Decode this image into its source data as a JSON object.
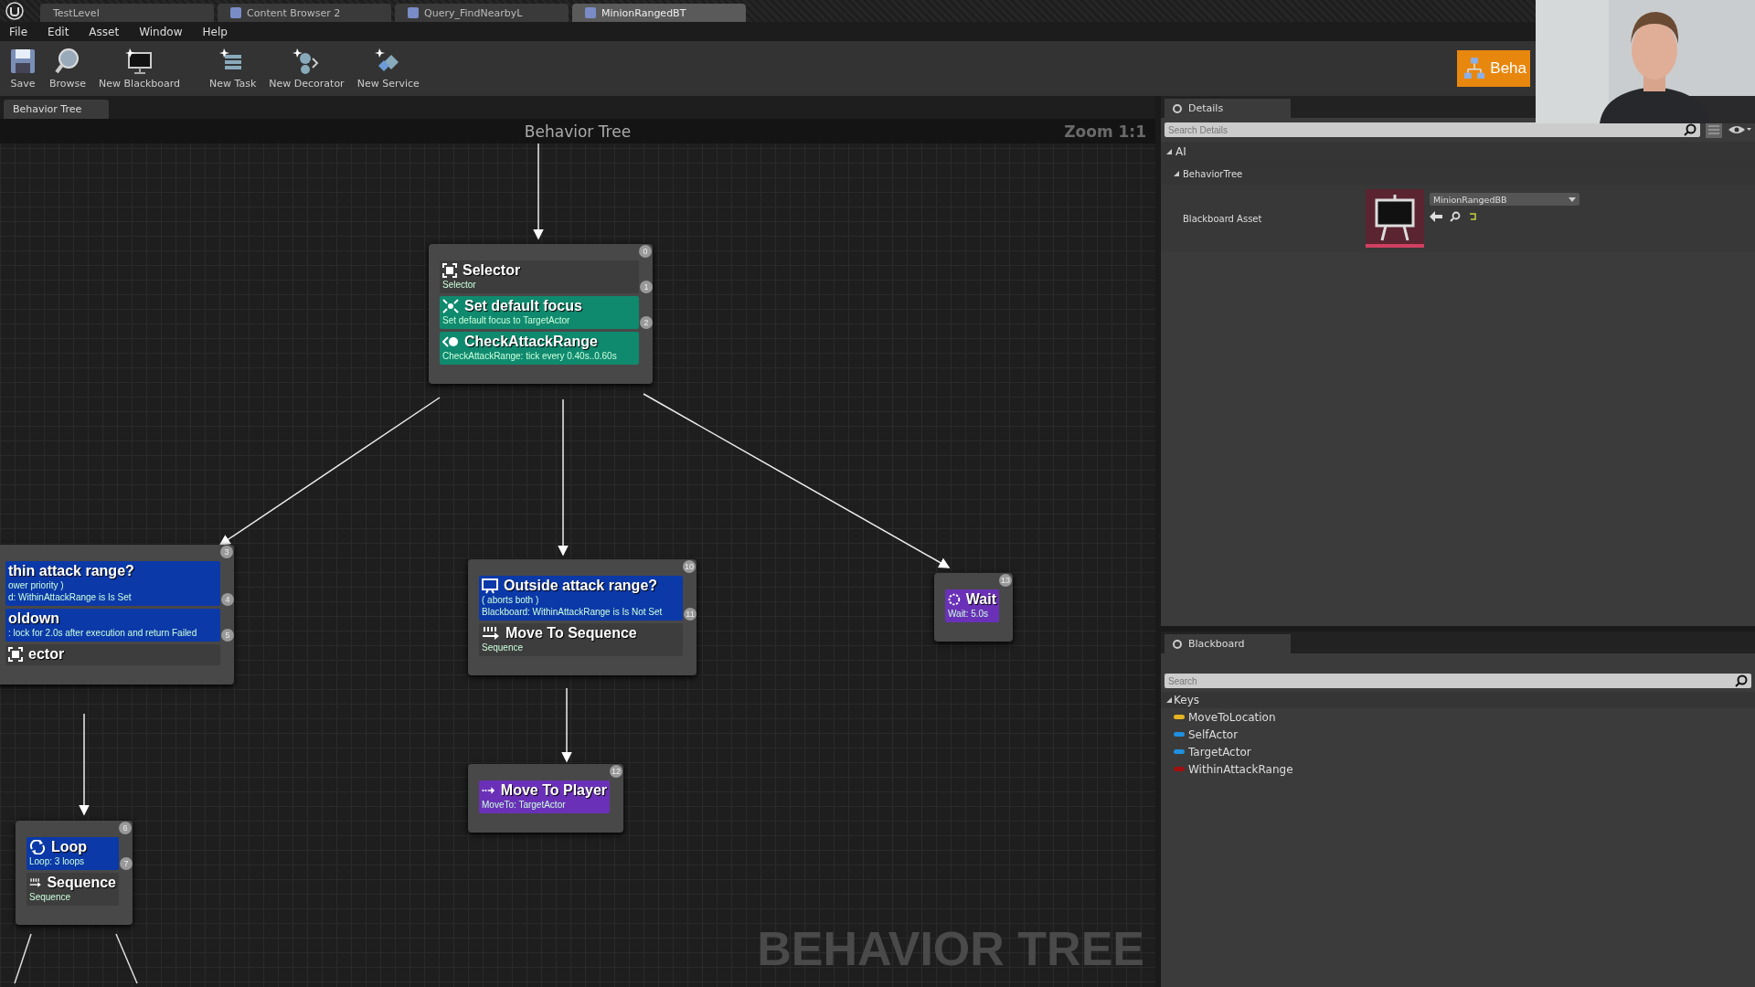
{
  "editor_tabs": [
    {
      "label": "TestLevel",
      "selected": false
    },
    {
      "label": "Content Browser 2",
      "selected": false
    },
    {
      "label": "Query_FindNearbyL",
      "selected": false
    },
    {
      "label": "MinionRangedBT",
      "selected": true
    }
  ],
  "menu": [
    "File",
    "Edit",
    "Asset",
    "Window",
    "Help"
  ],
  "toolbar": [
    {
      "label": "Save",
      "kind": "save"
    },
    {
      "label": "Browse",
      "kind": "browse"
    },
    {
      "label": "New Blackboard",
      "kind": "blackboard"
    },
    {
      "label": "New Task",
      "kind": "task"
    },
    {
      "label": "New Decorator",
      "kind": "decorator"
    },
    {
      "label": "New Service",
      "kind": "service"
    }
  ],
  "mode_button": {
    "label": "Beha"
  },
  "panel_tab": "Behavior Tree",
  "graph": {
    "title": "Behavior Tree",
    "zoom": "Zoom 1:1",
    "watermark": "BEHAVIOR TREE",
    "nodes": [
      {
        "index": "0",
        "sections": [
          {
            "kind": "composite",
            "title": "Selector",
            "lines": [
              "Selector"
            ],
            "badge": "1"
          },
          {
            "kind": "service",
            "title": "Set default focus",
            "lines": [
              "Set default focus to TargetActor"
            ],
            "badge": "2"
          },
          {
            "kind": "service",
            "title": "CheckAttackRange",
            "lines": [
              "CheckAttackRange: tick every 0.40s..0.60s"
            ]
          }
        ]
      },
      {
        "index": "3",
        "sections": [
          {
            "kind": "decorator",
            "title": "thin attack range?",
            "lines": [
              "ower priority )",
              "d: WithinAttackRange is Is Set"
            ],
            "badge": "4"
          },
          {
            "kind": "decorator",
            "title": "oldown",
            "lines": [
              ": lock for 2.0s after execution and return Failed"
            ],
            "badge": "5"
          },
          {
            "kind": "composite",
            "title": "ector"
          }
        ]
      },
      {
        "index": "10",
        "sections": [
          {
            "kind": "decorator",
            "title": "Outside attack range?",
            "lines": [
              "( aborts both )",
              "Blackboard: WithinAttackRange is Is Not Set"
            ],
            "badge": "11"
          },
          {
            "kind": "composite",
            "title": "Move To Sequence",
            "lines": [
              "Sequence"
            ]
          }
        ]
      },
      {
        "index": "13",
        "sections": [
          {
            "kind": "task",
            "title": "Wait",
            "lines": [
              "Wait: 5.0s"
            ]
          }
        ]
      },
      {
        "index": "12",
        "sections": [
          {
            "kind": "task",
            "title": "Move To Player",
            "lines": [
              "MoveTo: TargetActor"
            ]
          }
        ]
      },
      {
        "index": "6",
        "sections": [
          {
            "kind": "decorator",
            "title": "Loop",
            "lines": [
              "Loop: 3 loops"
            ],
            "badge": "7"
          },
          {
            "kind": "composite",
            "title": "Sequence",
            "lines": [
              "Sequence"
            ]
          }
        ]
      }
    ]
  },
  "details": {
    "tab": "Details",
    "search": {
      "placeholder": "Search Details"
    },
    "category": "AI",
    "subcategory": "BehaviorTree",
    "property": {
      "label": "Blackboard Asset",
      "value": "MinionRangedBB"
    }
  },
  "blackboard": {
    "tab": "Blackboard",
    "search": {
      "placeholder": "Search"
    },
    "group": "Keys",
    "keys": [
      {
        "name": "MoveToLocation",
        "color": "#e6b422"
      },
      {
        "name": "SelfActor",
        "color": "#1e90e0"
      },
      {
        "name": "TargetActor",
        "color": "#1e90e0"
      },
      {
        "name": "WithinAttackRange",
        "color": "#a01010"
      }
    ]
  },
  "webcam": {
    "kind": "picture"
  }
}
